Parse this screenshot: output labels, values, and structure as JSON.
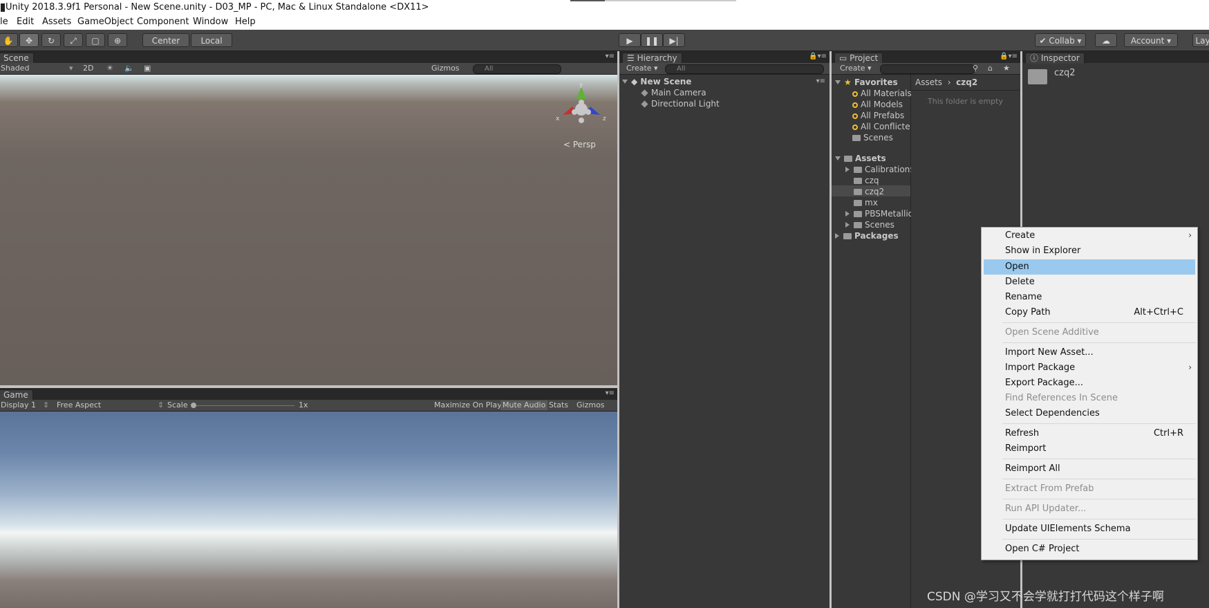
{
  "window": {
    "title": "Unity 2018.3.9f1 Personal - New Scene.unity - D03_MP - PC, Mac & Linux Standalone <DX11>"
  },
  "menu": [
    "le",
    "Edit",
    "Assets",
    "GameObject",
    "Component",
    "Window",
    "Help"
  ],
  "toolbar": {
    "pivot": "Center",
    "space": "Local",
    "collab": "Collab",
    "account": "Account",
    "layout": "Lay"
  },
  "scene": {
    "tab": "Scene",
    "shading": "Shaded",
    "mode2d": "2D",
    "gizmos": "Gizmos",
    "search": "All",
    "persp": "Persp",
    "axis_x": "x",
    "axis_y": "y",
    "axis_z": "z"
  },
  "game": {
    "tab": "Game",
    "display": "Display 1",
    "aspect": "Free Aspect",
    "scale_label": "Scale",
    "scale_value": "1x",
    "maximize": "Maximize On Play",
    "mute": "Mute Audio",
    "stats": "Stats",
    "gizmos": "Gizmos"
  },
  "hierarchy": {
    "tab": "Hierarchy",
    "create": "Create",
    "search": "All",
    "scene_name": "New Scene",
    "items": [
      "Main Camera",
      "Directional Light"
    ]
  },
  "project": {
    "tab": "Project",
    "create": "Create",
    "favorites_label": "Favorites",
    "favorites": [
      "All Materials",
      "All Models",
      "All Prefabs",
      "All Conflicte",
      "Scenes"
    ],
    "assets_label": "Assets",
    "assets": [
      "Calibration$",
      "czq",
      "czq2",
      "mx",
      "PBSMetallic",
      "Scenes"
    ],
    "packages_label": "Packages",
    "breadcrumb_root": "Assets",
    "breadcrumb_current": "czq2",
    "empty_text": "This folder is empty"
  },
  "inspector": {
    "tab": "Inspector",
    "name": "czq2"
  },
  "context_menu": {
    "items": [
      {
        "label": "Create",
        "submenu": true
      },
      {
        "label": "Show in Explorer"
      },
      {
        "label": "Open",
        "highlighted": true
      },
      {
        "label": "Delete"
      },
      {
        "label": "Rename"
      },
      {
        "label": "Copy Path",
        "shortcut": "Alt+Ctrl+C"
      },
      {
        "label": "Open Scene Additive",
        "disabled": true
      },
      {
        "label": "Import New Asset..."
      },
      {
        "label": "Import Package",
        "submenu": true
      },
      {
        "label": "Export Package..."
      },
      {
        "label": "Find References In Scene",
        "disabled": true
      },
      {
        "label": "Select Dependencies"
      },
      {
        "label": "Refresh",
        "shortcut": "Ctrl+R"
      },
      {
        "label": "Reimport"
      },
      {
        "label": "Reimport All"
      },
      {
        "label": "Extract From Prefab",
        "disabled": true
      },
      {
        "label": "Run API Updater...",
        "disabled": true
      },
      {
        "label": "Update UIElements Schema"
      },
      {
        "label": "Open C# Project"
      }
    ]
  },
  "watermark": "CSDN @学习又不会学就打打代码这个样子啊",
  "colors": {
    "highlight": "#99c9ef",
    "panel": "#383838",
    "toolbar": "#464646"
  }
}
